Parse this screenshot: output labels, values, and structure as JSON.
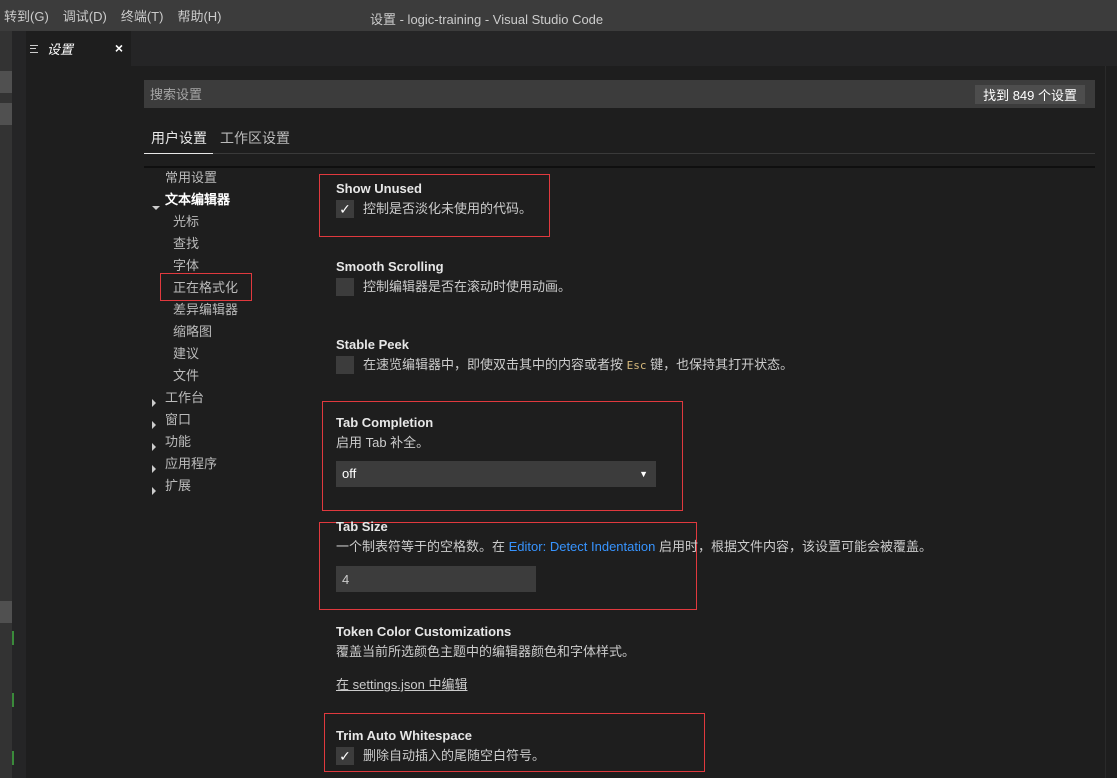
{
  "menu": [
    "转到(G)",
    "调试(D)",
    "终端(T)",
    "帮助(H)"
  ],
  "window_title": "设置 - logic-training - Visual Studio Code",
  "tab": {
    "label": "设置",
    "close": "×"
  },
  "search": {
    "placeholder": "搜索设置",
    "count": "找到 849 个设置"
  },
  "scope_tabs": [
    "用户设置",
    "工作区设置"
  ],
  "toc": [
    {
      "label": "常用设置",
      "indent": 1,
      "arrow": ""
    },
    {
      "label": "文本编辑器",
      "indent": 1,
      "arrow": "down",
      "bold": true
    },
    {
      "label": "光标",
      "indent": 2,
      "arrow": ""
    },
    {
      "label": "查找",
      "indent": 2,
      "arrow": ""
    },
    {
      "label": "字体",
      "indent": 2,
      "arrow": ""
    },
    {
      "label": "正在格式化",
      "indent": 2,
      "arrow": ""
    },
    {
      "label": "差异编辑器",
      "indent": 2,
      "arrow": ""
    },
    {
      "label": "缩略图",
      "indent": 2,
      "arrow": ""
    },
    {
      "label": "建议",
      "indent": 2,
      "arrow": ""
    },
    {
      "label": "文件",
      "indent": 2,
      "arrow": ""
    },
    {
      "label": "工作台",
      "indent": 1,
      "arrow": "right"
    },
    {
      "label": "窗口",
      "indent": 1,
      "arrow": "right"
    },
    {
      "label": "功能",
      "indent": 1,
      "arrow": "right"
    },
    {
      "label": "应用程序",
      "indent": 1,
      "arrow": "right"
    },
    {
      "label": "扩展",
      "indent": 1,
      "arrow": "right"
    }
  ],
  "settings": {
    "show_unused": {
      "title": "Show Unused",
      "desc": "控制是否淡化未使用的代码。",
      "checked": true
    },
    "smooth_scrolling": {
      "title": "Smooth Scrolling",
      "desc": "控制编辑器是否在滚动时使用动画。",
      "checked": false
    },
    "stable_peek": {
      "title": "Stable Peek",
      "desc_before": "在速览编辑器中，即使双击其中的内容或者按",
      "desc_code": "Esc",
      "desc_after": "键，也保持其打开状态。",
      "checked": false
    },
    "tab_completion": {
      "title": "Tab Completion",
      "desc": "启用 Tab 补全。",
      "value": "off"
    },
    "tab_size": {
      "title": "Tab Size",
      "desc_before": "一个制表符等于的空格数。在",
      "desc_link": "Editor: Detect Indentation",
      "desc_after": "启用时，根据文件内容，该设置可能会被覆盖。",
      "value": "4"
    },
    "token_color": {
      "title": "Token Color Customizations",
      "desc": "覆盖当前所选颜色主题中的编辑器颜色和字体样式。",
      "link": "在 settings.json 中编辑"
    },
    "trim_whitespace": {
      "title": "Trim Auto Whitespace",
      "desc": "删除自动插入的尾随空白符号。",
      "checked": true
    }
  },
  "checkmark": "✓",
  "caret": "▼"
}
